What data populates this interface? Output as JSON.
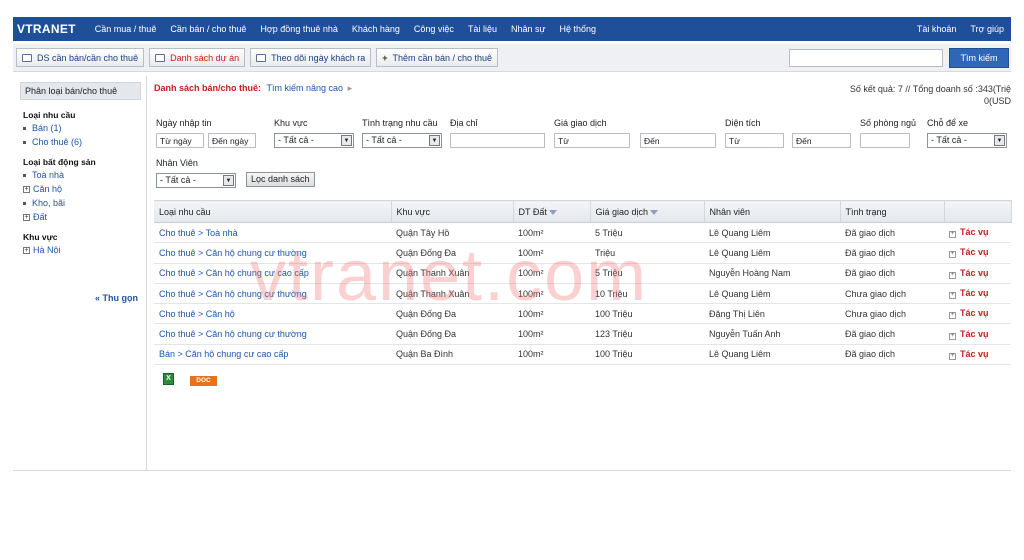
{
  "brand": "VTRANET",
  "nav": [
    "Cần mua / thuê",
    "Cần bán / cho thuê",
    "Hợp đồng thuê nhà",
    "Khách hàng",
    "Công việc",
    "Tài liệu",
    "Nhân sự",
    "Hệ thống"
  ],
  "nav_right": [
    "Tài khoản",
    "Trợ giúp"
  ],
  "toolbar": {
    "btn1": "DS cần bán/cần cho thuê",
    "btn2": "Danh sách dự án",
    "btn3": "Theo dõi ngày khách ra",
    "btn4": "Thêm cần bán / cho thuê",
    "search_value": "",
    "search_button": "Tìm kiếm"
  },
  "sidebar": {
    "title": "Phân loại bán/cho thuê",
    "sec1": "Loại nhu cầu",
    "sec1_items": [
      "Bán (1)",
      "Cho thuê (6)"
    ],
    "sec2": "Loại bất động sản",
    "sec2_items": [
      "Toà nhà",
      "Căn hộ",
      "Kho, bãi",
      "Đất"
    ],
    "sec3": "Khu vực",
    "sec3_items": [
      "Hà Nội"
    ],
    "collapse": "« Thu gọn"
  },
  "breadcrumb": {
    "part1": "Danh sách bán/cho thuê:",
    "part2": "Tìm kiếm nâng cao"
  },
  "results": {
    "line1": "Số kết quả: 7 // Tổng doanh số :343(Triệ",
    "line2": "0(USD"
  },
  "filters": {
    "date_label": "Ngày nhập tin",
    "date_from": "Từ ngày",
    "date_to": "Đến ngày",
    "area_label": "Khu vực",
    "area_value": "- Tất cả -",
    "status_label": "Tình trạng nhu cầu",
    "status_value": "- Tất cả -",
    "address_label": "Địa chỉ",
    "address_value": "",
    "price_label": "Giá giao dịch",
    "price_from": "Từ",
    "price_to": "Đến",
    "size_label": "Diện tích",
    "size_from": "Từ",
    "size_to": "Đến",
    "rooms_label": "Số phòng ngủ",
    "rooms_value": "",
    "parking_label": "Chỗ để xe",
    "parking_value": "- Tất cả -",
    "staff_label": "Nhân Viên",
    "staff_value": "- Tất cả -",
    "filter_button": "Lọc danh sách"
  },
  "table": {
    "headers": [
      "Loại nhu cầu",
      "Khu vực",
      "DT Đất",
      "Giá giao dịch",
      "Nhân viên",
      "Tình trạng",
      ""
    ],
    "action_label": "Tác vụ",
    "rows": [
      [
        "Cho thuê > Toà nhà",
        "Quận Tây Hồ",
        "100m²",
        "5 Triệu",
        "Lê Quang Liêm",
        "Đã giao dịch"
      ],
      [
        "Cho thuê > Căn hộ chung cư thường",
        "Quận Đống Đa",
        "100m²",
        "Triệu",
        "Lê Quang Liêm",
        "Đã giao dịch"
      ],
      [
        "Cho thuê > Căn hộ chung cư cao cấp",
        "Quận Thanh Xuân",
        "100m²",
        "5 Triệu",
        "Nguyễn Hoàng Nam",
        "Đã giao dịch"
      ],
      [
        "Cho thuê > Căn hộ chung cư thường",
        "Quận Thanh Xuân",
        "100m²",
        "10 Triệu",
        "Lê Quang Liêm",
        "Chưa giao dịch"
      ],
      [
        "Cho thuê > Căn hộ",
        "Quận Đống Đa",
        "100m²",
        "100 Triệu",
        "Đặng Thị Liên",
        "Chưa giao dịch"
      ],
      [
        "Cho thuê > Căn hộ chung cư thường",
        "Quận Đống Đa",
        "100m²",
        "123 Triệu",
        "Nguyễn Tuấn Anh",
        "Đã giao dịch"
      ],
      [
        "Bán > Căn hộ chung cư cao cấp",
        "Quận Ba Đình",
        "100m²",
        "100 Triệu",
        "Lê Quang Liêm",
        "Đã giao dịch"
      ]
    ]
  },
  "export": {
    "doc_label": "DOC"
  },
  "watermark": "vtranet.com"
}
